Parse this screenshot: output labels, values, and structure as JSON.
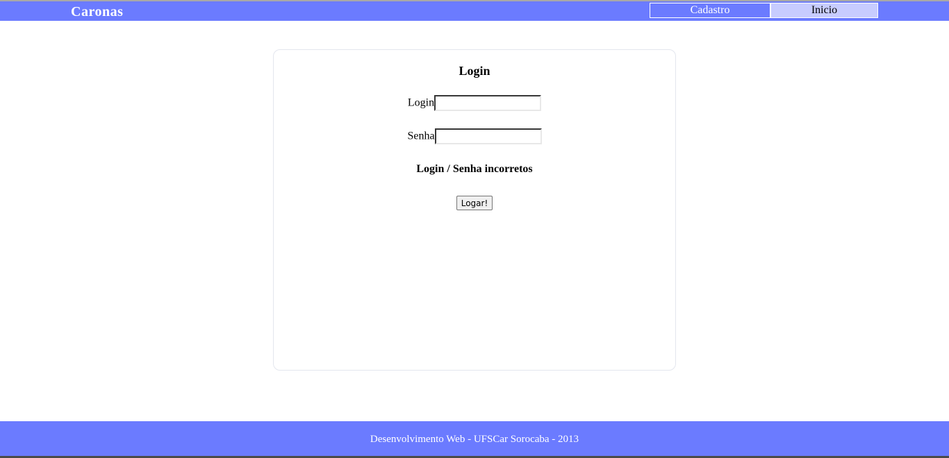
{
  "header": {
    "brand": "Caronas",
    "nav": [
      {
        "label": "Cadastro"
      },
      {
        "label": "Inicio"
      }
    ]
  },
  "login_card": {
    "title": "Login",
    "login_label": "Login",
    "login_value": "",
    "senha_label": "Senha",
    "senha_value": "",
    "error_message": "Login / Senha incorretos",
    "submit_label": "Logar!"
  },
  "footer": {
    "text": "Desenvolvimento Web - UFSCar Sorocaba - 2013"
  },
  "colors": {
    "header_bg": "#6b7bff",
    "active_nav_bg": "#c7ccff",
    "footer_bg": "#6b7bff"
  }
}
